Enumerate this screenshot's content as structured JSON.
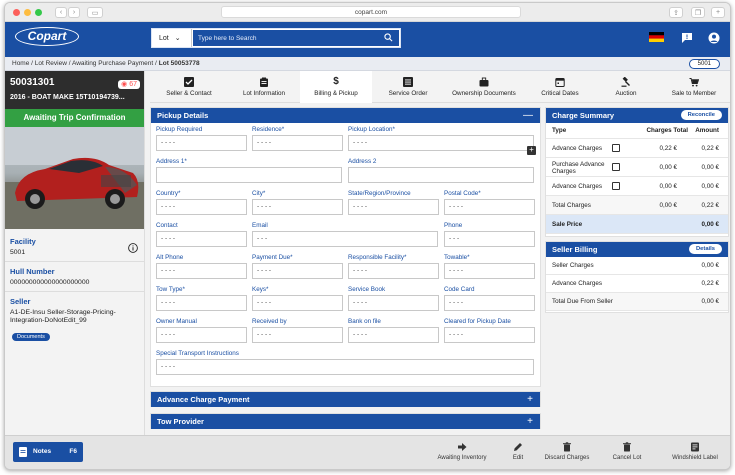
{
  "browser": {
    "url": "copart.com"
  },
  "header": {
    "logo": "Copart",
    "search_type": "Lot",
    "search_placeholder": "Type here to Search"
  },
  "breadcrumb": {
    "path": "Home / Lot Review / Awaiting Purchase Payment / ",
    "current": "Lot 50053778",
    "lot_badge": "5001"
  },
  "lot": {
    "number": "50031301",
    "watch_count": "67",
    "description": "2016 - BOAT MAKE 15T10194739...",
    "status": "Awaiting Trip Confirmation",
    "facility_label": "Facility",
    "facility_value": "5001",
    "hull_label": "Hull Number",
    "hull_value": "000000000000000000000",
    "seller_label": "Seller",
    "seller_value": "A1-DE-Insu Seller-Storage-Pricing-Integration-DoNotEdit_99",
    "documents_button": "Documents"
  },
  "tabs": [
    {
      "label": "Seller & Contact",
      "icon": "checkbox-icon"
    },
    {
      "label": "Lot Information",
      "icon": "clipboard-icon"
    },
    {
      "label": "Billing & Pickup",
      "icon": "dollar-icon"
    },
    {
      "label": "Service Order",
      "icon": "list-icon"
    },
    {
      "label": "Ownership Documents",
      "icon": "briefcase-icon"
    },
    {
      "label": "Critical Dates",
      "icon": "calendar-icon"
    },
    {
      "label": "Auction",
      "icon": "gavel-icon"
    },
    {
      "label": "Sale to Member",
      "icon": "cart-icon"
    }
  ],
  "pickup": {
    "title": "Pickup Details",
    "rows": [
      [
        {
          "label": "Pickup Required",
          "value": "- - - -"
        },
        {
          "label": "Residence*",
          "value": "- - - -"
        },
        {
          "label": "Pickup Location*",
          "value": "- - - -"
        }
      ],
      [
        {
          "label": "Address 1*",
          "value": ""
        },
        {
          "label": "Address 2",
          "value": ""
        }
      ],
      [
        {
          "label": "Country*",
          "value": "- - - -"
        },
        {
          "label": "City*",
          "value": "- - - -"
        },
        {
          "label": "State/Region/Province",
          "value": "- - - -"
        },
        {
          "label": "Postal Code*",
          "value": "- - - -"
        }
      ],
      [
        {
          "label": "Contact",
          "value": "- - - -"
        },
        {
          "label": "Email",
          "value": "- - -"
        },
        {
          "label": "Phone",
          "value": "- - -"
        }
      ],
      [
        {
          "label": "Alt Phone",
          "value": "- - - -"
        },
        {
          "label": "Payment Due*",
          "value": "- - - -"
        },
        {
          "label": "Responsible Facility*",
          "value": "- - - -"
        },
        {
          "label": "Towable*",
          "value": "- - - -"
        }
      ],
      [
        {
          "label": "Tow Type*",
          "value": "- - - -"
        },
        {
          "label": "Keys*",
          "value": "- - - -"
        },
        {
          "label": "Service Book",
          "value": "- - - -"
        },
        {
          "label": "Code Card",
          "value": "- - - -"
        }
      ],
      [
        {
          "label": "Owner Manual",
          "value": "- - - -"
        },
        {
          "label": "Received by",
          "value": "- - - -"
        },
        {
          "label": "Bank on file",
          "value": "- - - -"
        },
        {
          "label": "Cleared for Pickup Date",
          "value": "- - - -"
        }
      ],
      [
        {
          "label": "Special Transport Instructions",
          "value": "- - - -"
        }
      ]
    ]
  },
  "advance_panel": {
    "title": "Advance Charge Payment"
  },
  "tow_panel": {
    "title": "Tow Provider"
  },
  "charge_summary": {
    "title": "Charge Summary",
    "button": "Reconcile",
    "col_type": "Type",
    "col_charges": "Charges Total",
    "col_amount": "Amount",
    "rows": [
      {
        "type": "Advance Charges",
        "charges": "0,22 €",
        "amount": "0,22 €"
      },
      {
        "type": "Purchase Advance Charges",
        "charges": "0,00 €",
        "amount": "0,00 €"
      },
      {
        "type": "Advance Charges",
        "charges": "0,00 €",
        "amount": "0,00 €"
      },
      {
        "type": "Total Charges",
        "charges": "0,00 €",
        "amount": "0,22 €"
      },
      {
        "type": "Sale Price",
        "charges": "",
        "amount": "0,00 €"
      }
    ]
  },
  "seller_billing": {
    "title": "Seller Billing",
    "button": "Details",
    "rows": [
      {
        "type": "Seller Charges",
        "amount": "0,00 €"
      },
      {
        "type": "Advance Charges",
        "amount": "0,22 €"
      },
      {
        "type": "Total Due From Seller",
        "amount": "0,00 €"
      }
    ]
  },
  "bottom": {
    "notes": "Notes",
    "notes_key": "F6",
    "actions": [
      "Awaiting Inventory",
      "Edit",
      "Discard Charges",
      "Cancel Lot",
      "Windshield Label"
    ]
  },
  "colors": {
    "brand": "#1a4fa3",
    "status_green": "#33a043",
    "lot_card": "#2d2d2d"
  }
}
